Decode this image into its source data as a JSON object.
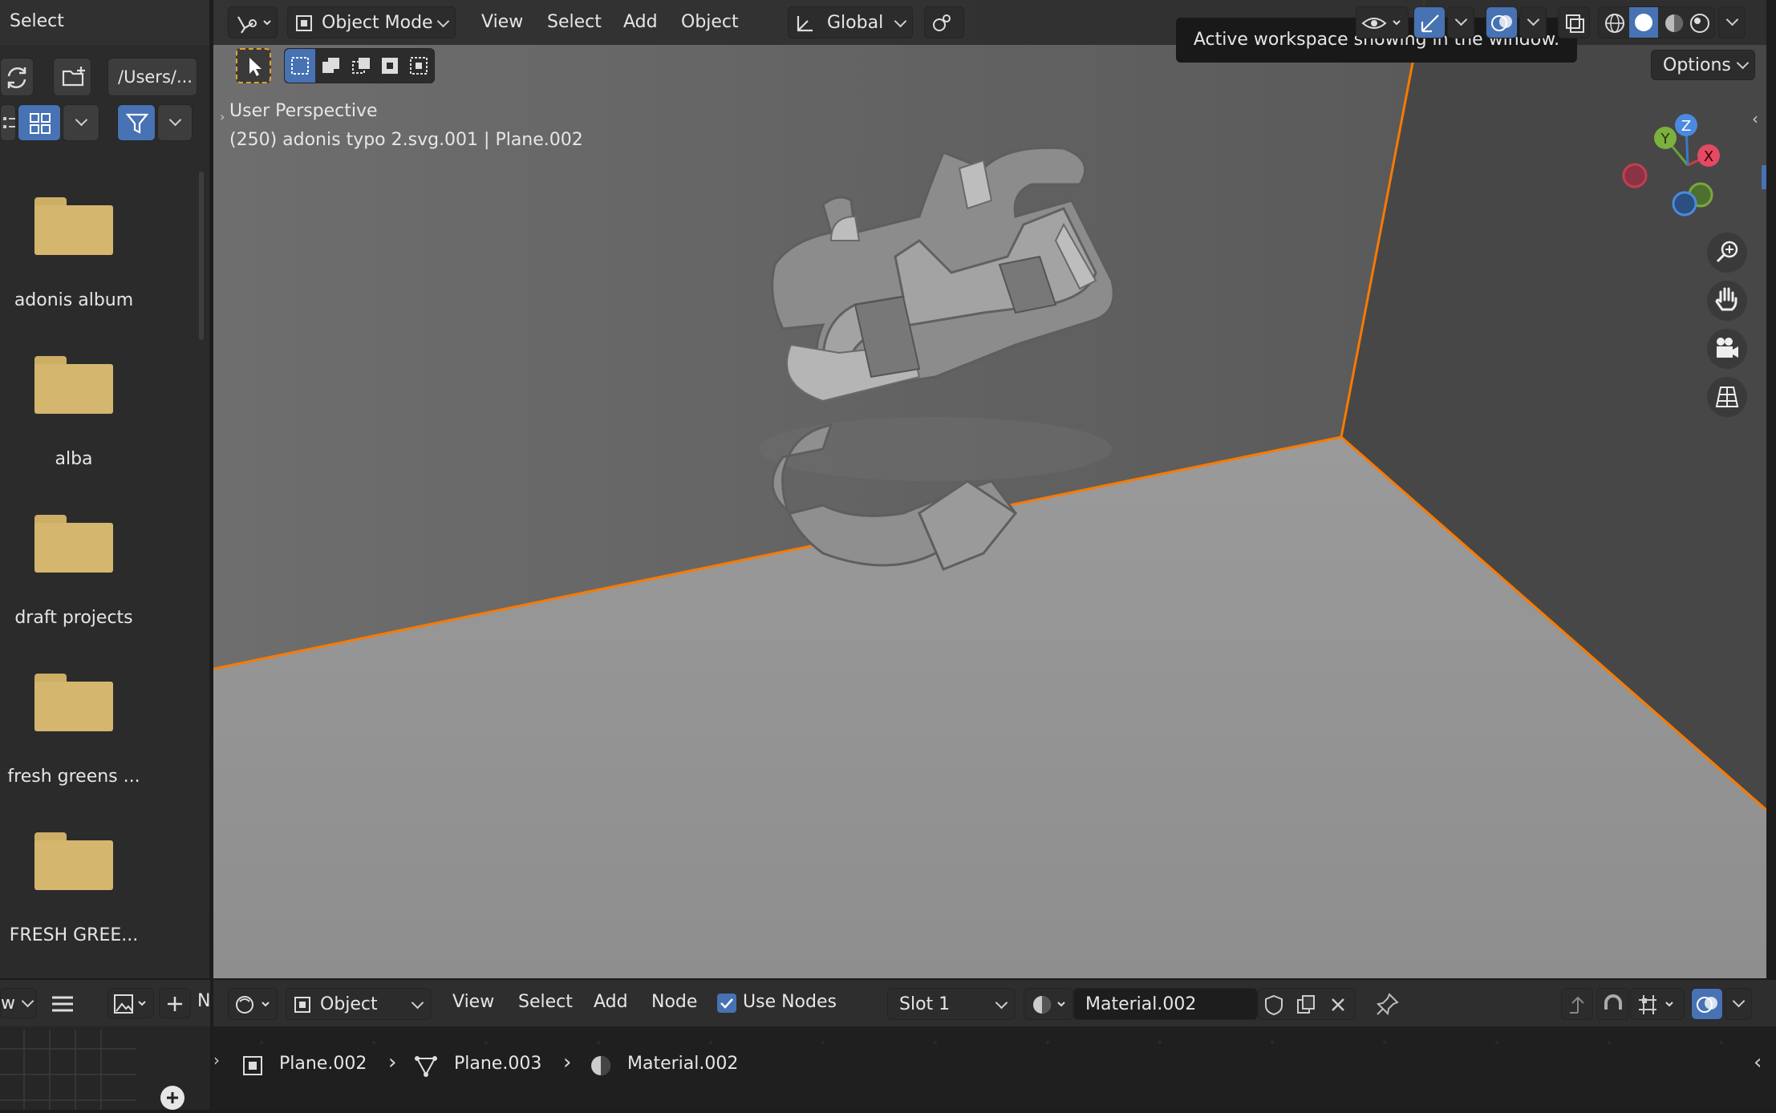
{
  "file_browser": {
    "title": "Select",
    "path": "/Users/...",
    "folders": [
      {
        "label": "adonis album"
      },
      {
        "label": "alba"
      },
      {
        "label": "draft projects"
      },
      {
        "label": "fresh greens ..."
      },
      {
        "label": "FRESH GREE..."
      }
    ]
  },
  "viewport_header": {
    "mode": "Object Mode",
    "menus": [
      "View",
      "Select",
      "Add",
      "Object"
    ],
    "transform_orientation": "Global",
    "options": "Options"
  },
  "tooltip": "Active workspace showing in the window.",
  "viewport_info": {
    "line1": "User Perspective",
    "line2": "(250) adonis typo 2.svg.001 | Plane.002"
  },
  "gizmo": {
    "x": "X",
    "y": "Y",
    "z": "Z"
  },
  "colors": {
    "selection_outline": "#f97a00",
    "header_bg": "#2e2e2e",
    "accent": "#4772b3"
  },
  "node_editor": {
    "left_label": "w",
    "left_letter": "N",
    "mode": "Object",
    "menus": [
      "View",
      "Select",
      "Add",
      "Node"
    ],
    "use_nodes_label": "Use Nodes",
    "slot": "Slot 1",
    "material": "Material.002",
    "breadcrumb": {
      "object": "Plane.002",
      "mesh": "Plane.003",
      "material": "Material.002"
    }
  }
}
